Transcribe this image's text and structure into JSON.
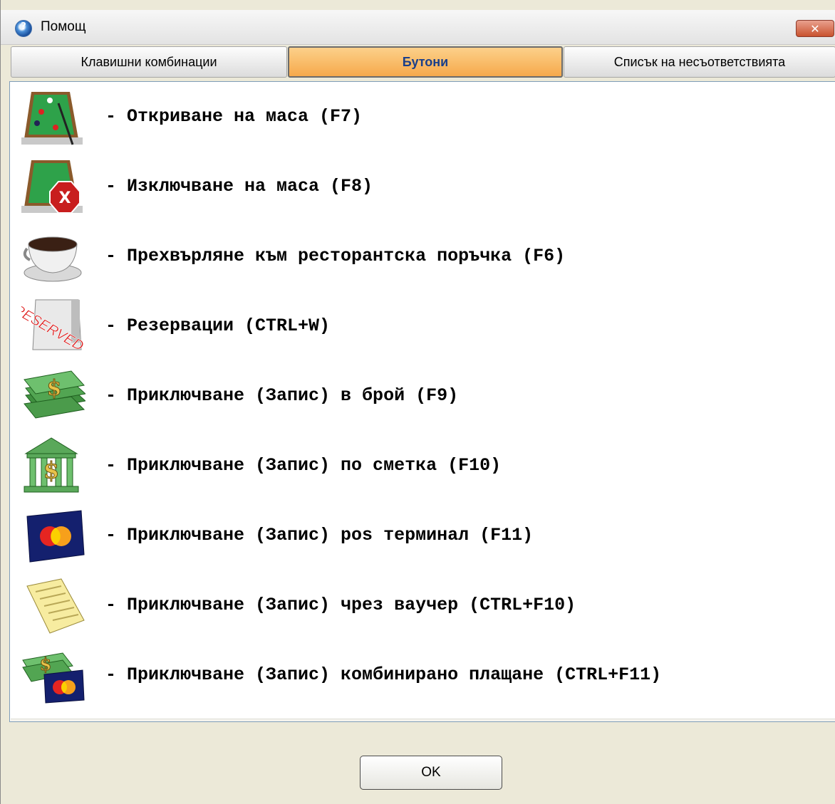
{
  "window": {
    "title": "Помощ"
  },
  "tabs": [
    {
      "label": "Клавишни комбинации",
      "active": false
    },
    {
      "label": "Бутони",
      "active": true
    },
    {
      "label": "Списък на несъответствията",
      "active": false
    }
  ],
  "items": [
    {
      "icon": "billiard-table-icon",
      "label": "- Откриване на маса (F7)"
    },
    {
      "icon": "billiard-table-close-icon",
      "label": "- Изключване на маса (F8)"
    },
    {
      "icon": "coffee-cup-icon",
      "label": "- Прехвърляне към ресторантска поръчка (F6)"
    },
    {
      "icon": "reserved-sign-icon",
      "label": "- Резервации (CTRL+W)",
      "icon_text": "RESERVED"
    },
    {
      "icon": "cash-money-icon",
      "label": "- Приключване (Запис) в брой (F9)"
    },
    {
      "icon": "bank-icon",
      "label": "- Приключване (Запис) по сметка (F10)"
    },
    {
      "icon": "credit-card-icon",
      "label": "- Приключване (Запис) pos терминал (F11)"
    },
    {
      "icon": "voucher-icon",
      "label": "- Приключване (Запис) чрез ваучер (CTRL+F10)"
    },
    {
      "icon": "combined-payment-icon",
      "label": "- Приключване (Запис) комбинирано плащане (CTRL+F11)"
    }
  ],
  "buttons": {
    "ok_label": "OK"
  },
  "colors": {
    "active_tab": "#f6a94b",
    "active_tab_text": "#1a3f8a",
    "window_bg": "#ece9d8"
  }
}
